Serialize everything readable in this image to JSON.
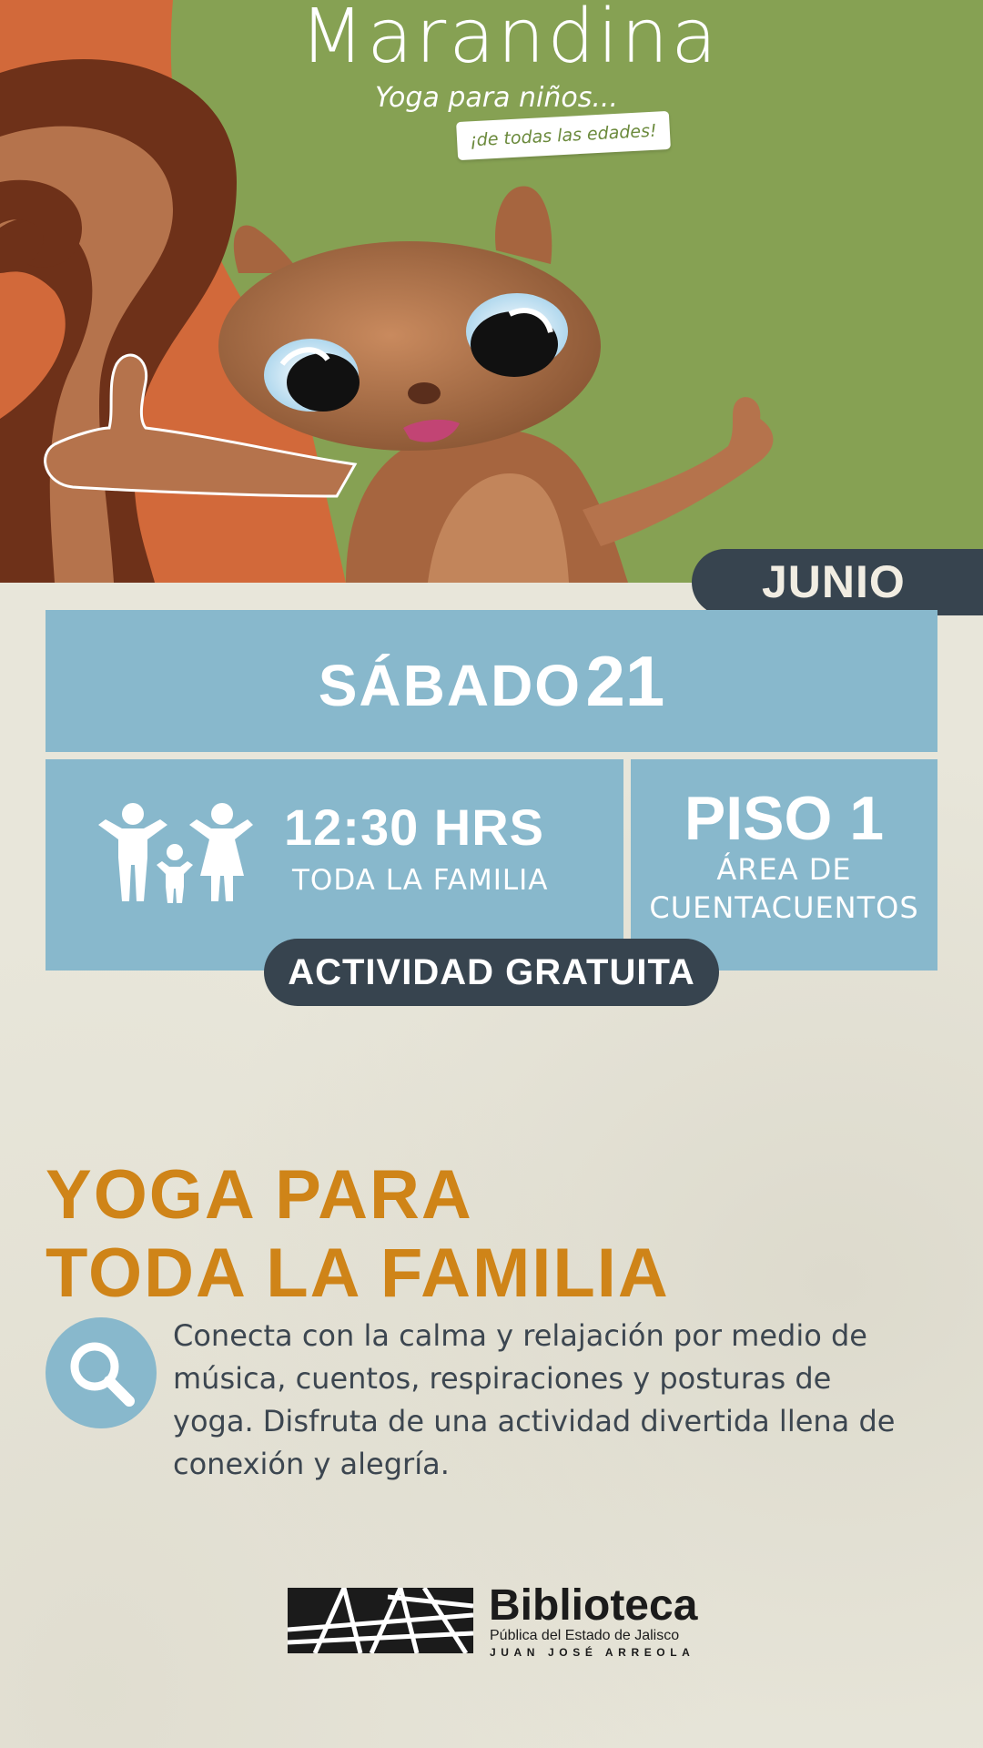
{
  "hero": {
    "title": "Marandina",
    "subtitle": "Yoga para niños...",
    "tag": "¡de todas las edades!"
  },
  "month": "JUNIO",
  "date": {
    "weekday": "SÁBADO",
    "day": "21"
  },
  "time": {
    "main": "12:30 HRS",
    "audience": "TODA LA FAMILIA"
  },
  "place": {
    "floor": "PISO 1",
    "area_line1": "ÁREA DE",
    "area_line2": "CUENTACUENTOS"
  },
  "price_badge": "ACTIVIDAD GRATUITA",
  "event": {
    "title_line1": "YOGA PARA",
    "title_line2": "TODA LA FAMILIA",
    "description": "Conecta con la calma y relajación por medio de música, cuentos, respiraciones y posturas de yoga. Disfruta de una actividad divertida llena de conexión y alegría."
  },
  "logo": {
    "name": "Biblioteca",
    "line1": "Pública del Estado de Jalisco",
    "line2": "JUAN JOSÉ ARREOLA"
  },
  "icons": [
    "family-icon",
    "search-icon",
    "squirrel-illustration",
    "library-logo-mark"
  ],
  "colors": {
    "hero_green": "#86a153",
    "hero_orange": "#d2693a",
    "squirrel_brown": "#b5734c",
    "info_blue": "#88b8cc",
    "dark_slate": "#37444f",
    "title_orange": "#cf8418",
    "paper": "#e8e6da"
  }
}
